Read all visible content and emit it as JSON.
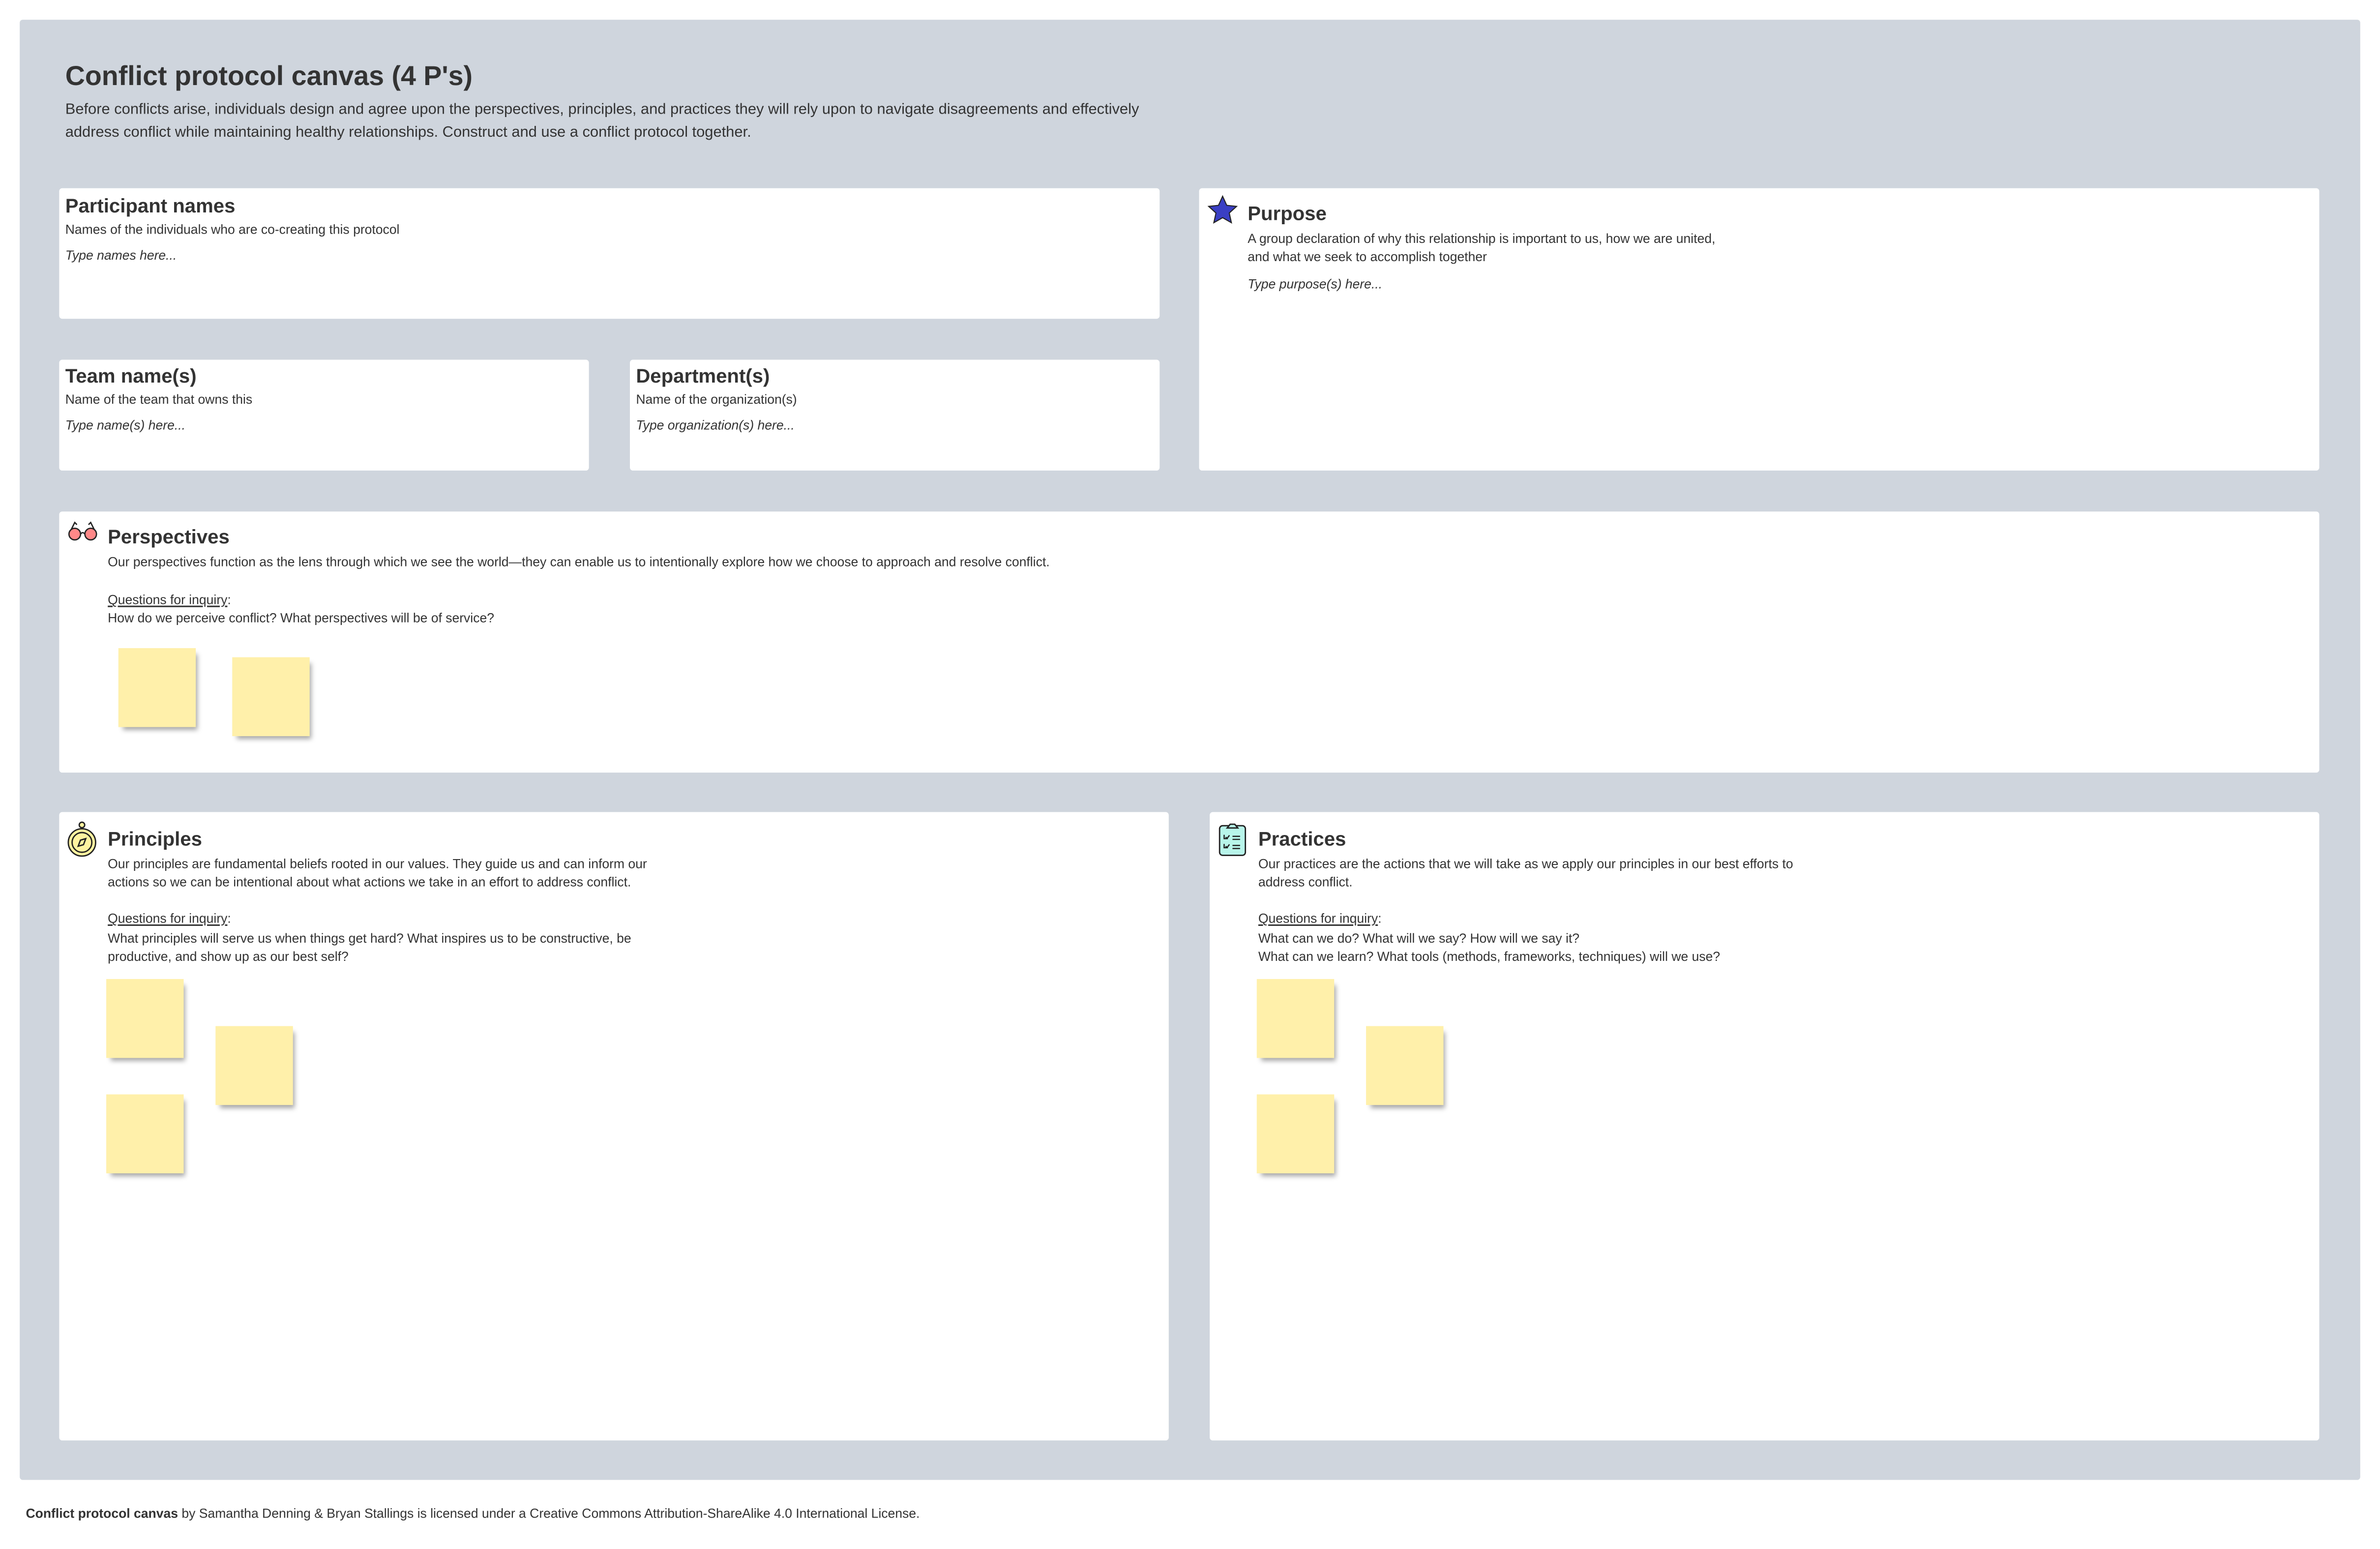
{
  "header": {
    "title": "Conflict protocol canvas (4 P's)",
    "description": "Before conflicts arise, individuals design and agree upon the perspectives, principles, and practices they will rely upon to navigate disagreements and effectively address conflict while maintaining healthy relationships. Construct and use a conflict protocol together."
  },
  "participants": {
    "title": "Participant names",
    "subtitle": "Names of the individuals who are co-creating this protocol",
    "placeholder": "Type names here..."
  },
  "team": {
    "title": "Team name(s)",
    "subtitle": "Name of the team that owns this",
    "placeholder": "Type name(s) here..."
  },
  "department": {
    "title": "Department(s)",
    "subtitle": "Name of the organization(s)",
    "placeholder": "Type organization(s) here..."
  },
  "purpose": {
    "title": "Purpose",
    "subtitle": "A group declaration of why this relationship is important to us, how we are united, and what we seek to accomplish together",
    "placeholder": "Type purpose(s) here...",
    "icon": "star-icon",
    "icon_color": "#3a3fc4"
  },
  "perspectives": {
    "title": "Perspectives",
    "description": "Our perspectives function as the lens through which we see the world—they can enable us to intentionally explore how we choose to approach and resolve conflict.",
    "inquiry_label": "Questions for inquiry",
    "inquiry_text": "How do we perceive conflict? What perspectives will be of service?",
    "icon": "glasses-icon"
  },
  "principles": {
    "title": "Principles",
    "description": "Our principles are fundamental beliefs rooted in our values. They guide us and can inform our actions so we can be intentional about what actions we take in an effort to address conflict.",
    "inquiry_label": "Questions for inquiry",
    "inquiry_text": "What principles will serve us when things get hard? What inspires us to be constructive, be productive, and show up as our best self?",
    "icon": "compass-icon"
  },
  "practices": {
    "title": "Practices",
    "description": "Our practices are the actions that we will take as we apply our principles in our best efforts to address conflict.",
    "inquiry_label": "Questions for inquiry",
    "inquiry_line1": "What can we do? What will we say? How will we say it?",
    "inquiry_line2": "What can we learn? What tools (methods, frameworks, techniques) will we use?",
    "icon": "clipboard-checklist-icon"
  },
  "colors": {
    "background": "#cfd5dd",
    "sticky": "#fff0aa"
  },
  "footer": {
    "bold": "Conflict protocol canvas",
    "text": " by Samantha Denning & Bryan Stallings is licensed under a Creative Commons Attribution-ShareAlike 4.0 International License."
  }
}
